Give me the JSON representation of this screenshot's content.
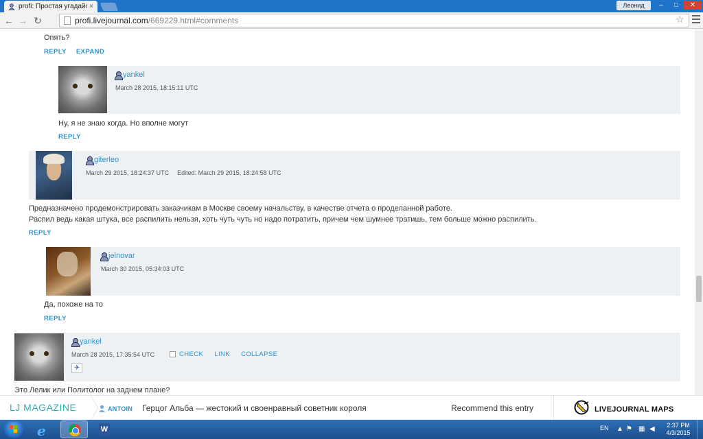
{
  "browser": {
    "tab_title": "profi: Простая угадайка",
    "tab_close": "×",
    "profile_name": "Леонид",
    "window_min": "–",
    "window_max": "□",
    "window_close": "✕",
    "url_host": "profi.livejournal.com",
    "url_path": "/669229.html#comments",
    "back": "←",
    "forward": "→",
    "reload": "↻",
    "star": "☆"
  },
  "comments": {
    "top_text": "Опять?",
    "top_actions": [
      "REPLY",
      "EXPAND"
    ],
    "c1": {
      "username": "yankel",
      "meta": "March 28 2015, 18:15:11 UTC",
      "body": "Ну, я не знаю когда. Но вполне могут",
      "action": "REPLY"
    },
    "c2": {
      "username": "giterleo",
      "meta": "March 29 2015, 18:24:37 UTC",
      "edited": "Edited:  March 29 2015, 18:24:58 UTC",
      "body1": "Предназначено продемонстрировать заказчикам в Москве своему начальству, в качестве отчета о проделанной работе.",
      "body2": "Распил ведь какая штука, все распилить нельзя, хоть чуть чуть но надо потратить, причем чем шумнее тратишь, тем больше можно распилить.",
      "action": "REPLY"
    },
    "c3": {
      "username": "jelnovar",
      "meta": "March 30 2015, 05:34:03 UTC",
      "body": "Да, похоже на то",
      "action": "REPLY"
    },
    "c4": {
      "username": "yankel",
      "meta": "March 28 2015, 17:35:54 UTC",
      "check": "CHECK",
      "link": "LINK",
      "collapse": "COLLAPSE",
      "body": "Это Лелик или Политолог на заднем плане?"
    }
  },
  "ljbar": {
    "magazine": "LJ MAGAZINE",
    "user": "ANTOIN",
    "headline": "Герцог Альба — жестокий и своенравный советник короля",
    "recommend": "Recommend this entry",
    "logo_text": "LIVEJOURNAL MAPS"
  },
  "taskbar": {
    "lang": "EN",
    "time": "2:37 PM",
    "date": "4/3/2015",
    "ie_glyph": "e",
    "word_glyph": "W"
  }
}
